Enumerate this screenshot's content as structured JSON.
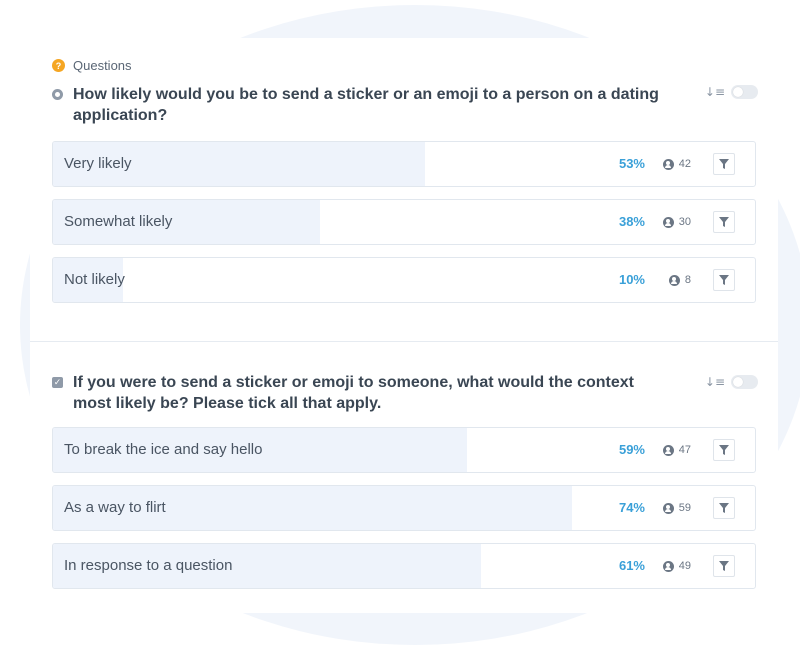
{
  "breadcrumb": {
    "label": "Questions"
  },
  "questions": [
    {
      "text": "How likely would you be to send a sticker or an emoji to a person on a dating application?",
      "type": "single",
      "options": [
        {
          "label": "Very likely",
          "percent": "53%",
          "fraction": 0.53,
          "count": "42"
        },
        {
          "label": "Somewhat likely",
          "percent": "38%",
          "fraction": 0.38,
          "count": "30"
        },
        {
          "label": "Not likely",
          "percent": "10%",
          "fraction": 0.1,
          "count": "8"
        }
      ]
    },
    {
      "text": "If you were to send a sticker or emoji to someone, what would the context most likely be? Please tick all that apply.",
      "type": "multiple",
      "options": [
        {
          "label": "To break the ice and say hello",
          "percent": "59%",
          "fraction": 0.59,
          "count": "47"
        },
        {
          "label": "As a way to flirt",
          "percent": "74%",
          "fraction": 0.74,
          "count": "59"
        },
        {
          "label": "In response to a question",
          "percent": "61%",
          "fraction": 0.61,
          "count": "49"
        }
      ]
    }
  ],
  "icons": {
    "breadcrumb": "question-icon",
    "sort": "sort-icon",
    "count": "user-icon",
    "filter": "filter-icon"
  },
  "colors": {
    "percent": "#3aa0d8",
    "bar_fill": "#eef3fb",
    "badge": "#f5a623"
  }
}
